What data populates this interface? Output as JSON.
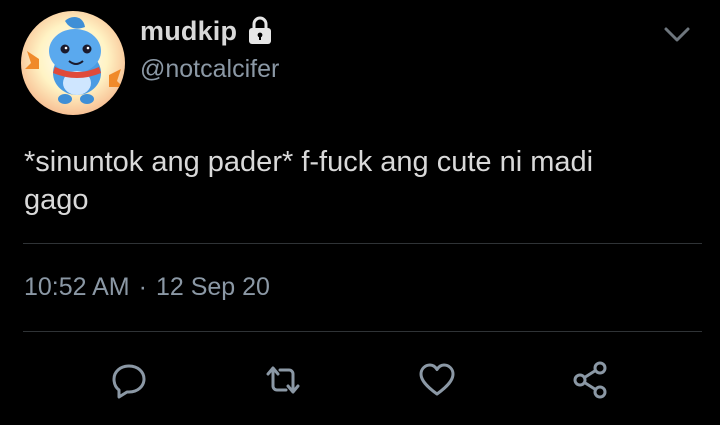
{
  "tweet": {
    "display_name": "mudkip",
    "handle": "@notcalcifer",
    "protected": true,
    "text_line1": "*sinuntok ang pader* f-fuck ang cute ni madi",
    "text_line2": "gago",
    "time": "10:52 AM",
    "separator": "·",
    "date": "12 Sep 20"
  },
  "icons": {
    "avatar": "mudkip-avatar",
    "lock": "lock-icon",
    "menu": "chevron-down-icon",
    "reply": "reply-icon",
    "retweet": "retweet-icon",
    "like": "heart-icon",
    "share": "share-icon"
  },
  "colors": {
    "background": "#000000",
    "primary_text": "#d9d9d9",
    "secondary_text": "#8b98a5",
    "divider": "#2f3336"
  }
}
